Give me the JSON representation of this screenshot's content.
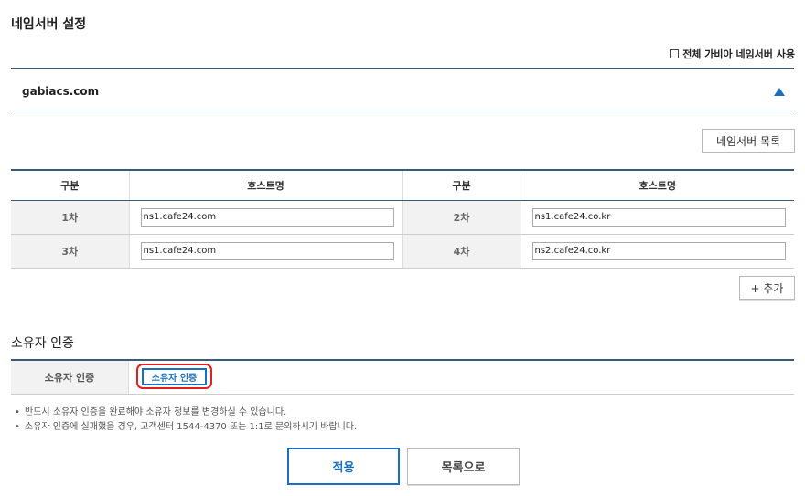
{
  "page": {
    "title": "네임서버 설정"
  },
  "all_gabia": {
    "label": "전체 가비아 네임서버 사용",
    "checked": false
  },
  "domain": {
    "name": "gabiacs.com"
  },
  "buttons": {
    "ns_list": "네임서버 목록",
    "add": "+ 추가",
    "apply": "적용",
    "back": "목록으로"
  },
  "table": {
    "headers": [
      "구분",
      "호스트명",
      "구분",
      "호스트명"
    ],
    "rows": [
      {
        "label1": "1차",
        "host1": "ns1.cafe24.com",
        "label2": "2차",
        "host2": "ns1.cafe24.co.kr"
      },
      {
        "label1": "3차",
        "host1": "ns1.cafe24.com",
        "label2": "4차",
        "host2": "ns2.cafe24.co.kr"
      }
    ]
  },
  "owner": {
    "section_title": "소유자 인증",
    "row_label": "소유자 인증",
    "button": "소유자 인증"
  },
  "notes": [
    "반드시 소유자 인증을 완료해야 소유자 정보를 변경하실 수 있습니다.",
    "소유자 인증에 실패했을 경우, 고객센터 1544-4370 또는 1:1로 문의하시기 바랍니다."
  ],
  "colors": {
    "accent": "#1a6fc0",
    "highlight": "#e02020",
    "border": "#3a5a7a"
  }
}
